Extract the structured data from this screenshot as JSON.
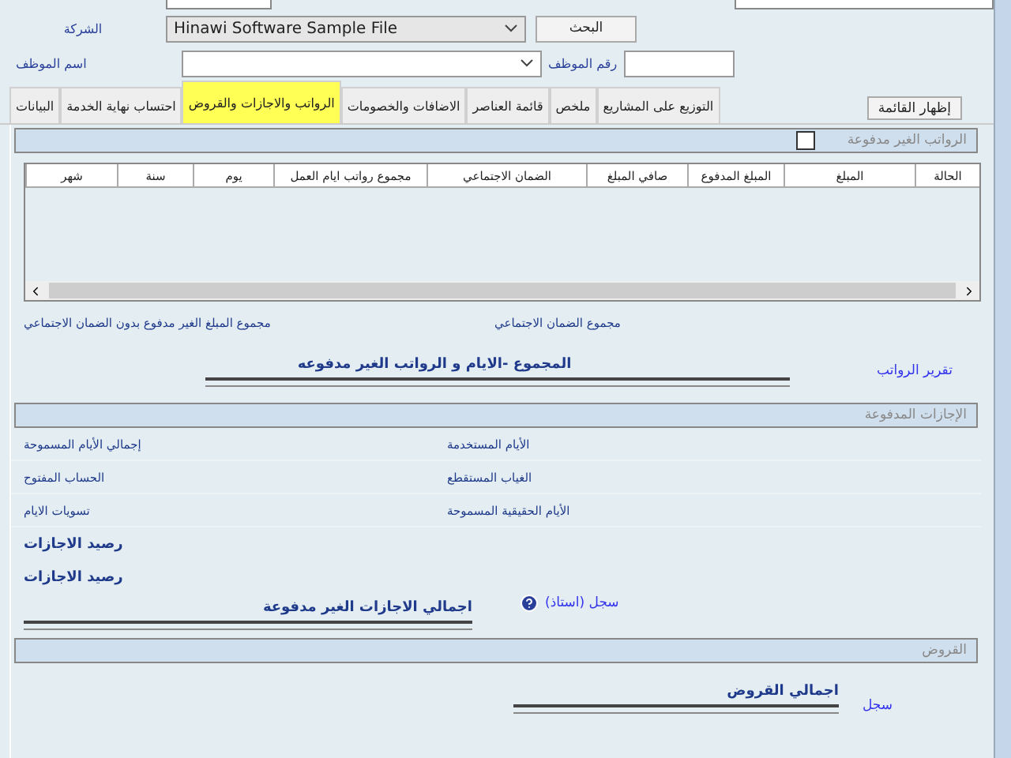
{
  "form": {
    "company_label": "الشركة",
    "company_value": "Hinawi Software Sample File",
    "search_button": "البحث",
    "employee_name_label": "اسم الموظف",
    "employee_number_label": "رقم الموظف"
  },
  "show_list_button": "إظهار القائمة",
  "tabs": [
    {
      "label": "التوزيع على المشاريع",
      "selected": false
    },
    {
      "label": "ملخص",
      "selected": false
    },
    {
      "label": "قائمة العناصر",
      "selected": false
    },
    {
      "label": "الاضافات والخصومات",
      "selected": false
    },
    {
      "label": "الرواتب والاجازات والقروض",
      "selected": true
    },
    {
      "label": "احتساب نهاية الخدمة",
      "selected": false
    },
    {
      "label": "البيانات",
      "selected": false
    }
  ],
  "unpaid_salaries": {
    "title": "الرواتب الغير مدفوعة",
    "checked": false,
    "columns": [
      "الحالة",
      "المبلغ",
      "المبلغ المدفوع",
      "صافي المبلغ",
      "الضمان الاجتماعي",
      "مجموع رواتب ايام العمل",
      "يوم",
      "سنة",
      "شهر"
    ],
    "total_unpaid_label": "مجموع المبلغ الغير مدفوع بدون الضمان الاجتماعي",
    "total_social_label": "مجموع الضمان الاجتماعي",
    "total_title": "المجموع  -الايام و الرواتب الغير مدفوعه",
    "report_link": "تقرير الرواتب"
  },
  "paid_leaves": {
    "title": "الإجازات المدفوعة",
    "rows": [
      {
        "left": "إجمالي الأيام المسموحة",
        "middle": "الأيام المستخدمة"
      },
      {
        "left": "الحساب المفتوح",
        "middle": "الغياب المستقطع"
      },
      {
        "left": "تسويات الايام",
        "middle": "الأيام الحقيقية المسموحة"
      }
    ],
    "balance_labels": [
      "رصيد الاجازات",
      "رصيد الاجازات"
    ],
    "ledger_link": "سجل (استاذ)",
    "total_unpaid_title": "اجمالي الاجازات الغير مدفوعة"
  },
  "loans": {
    "title": "القروض",
    "total_title": "اجمالي القروض",
    "ledger_link": "سجل"
  }
}
